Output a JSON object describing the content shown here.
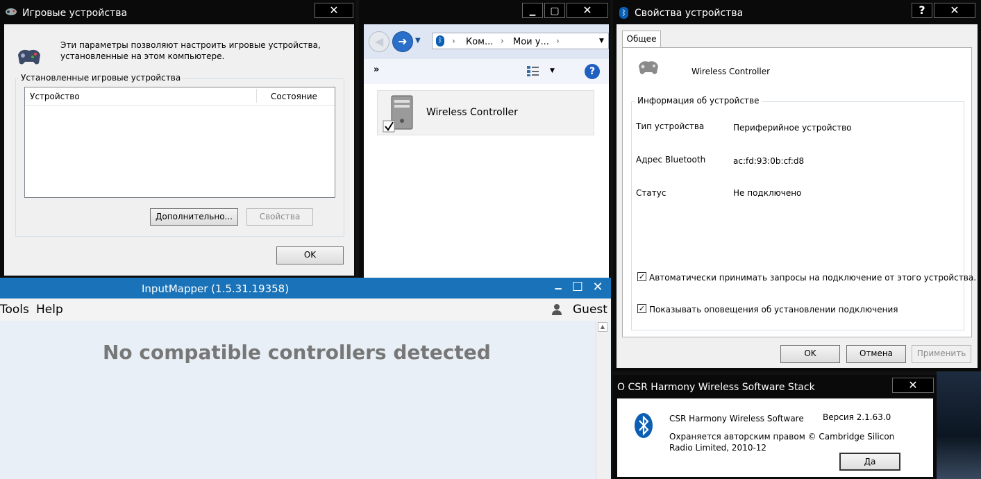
{
  "game_devices": {
    "title": "Игровые устройства",
    "description": "Эти параметры позволяют настроить игровые устройства, установленные на этом компьютере.",
    "group_label": "Установленные игровые устройства",
    "columns": [
      "Устройство",
      "Состояние"
    ],
    "advanced_label": "Дополнительно...",
    "properties_label": "Свойства",
    "ok_label": "OK",
    "close_symbol": "✕"
  },
  "explorer": {
    "breadcrumb": [
      "Ком...",
      "Мои у..."
    ],
    "overflow_symbol": "»",
    "help_symbol": "?",
    "device_name": "Wireless Controller",
    "min_symbol": "▁",
    "max_symbol": "▢",
    "close_symbol": "✕"
  },
  "props": {
    "title": "Свойства устройства",
    "tab": "Общее",
    "device_name": "Wireless Controller",
    "info_group": "Информация об устройстве",
    "rows": [
      {
        "label": "Тип устройства",
        "value": "Периферийное устройство"
      },
      {
        "label": "Адрес Bluetooth",
        "value": "ac:fd:93:0b:cf:d8"
      },
      {
        "label": "Статус",
        "value": "Не подключено"
      }
    ],
    "checkbox1": "Автоматически принимать запросы на подключение от этого устройства.",
    "checkbox2": "Показывать оповещения об установлении подключения",
    "ok_label": "OK",
    "cancel_label": "Отмена",
    "apply_label": "Применить",
    "help_symbol": "?",
    "close_symbol": "✕"
  },
  "inputmapper": {
    "title": "InputMapper (1.5.31.19358)",
    "menu": [
      "Tools",
      "Help"
    ],
    "user": "Guest",
    "message": "No compatible controllers detected",
    "min_symbol": "▁",
    "max_symbol": "☐",
    "close_symbol": "✕"
  },
  "csr": {
    "title": "О CSR Harmony Wireless Software Stack",
    "product": "CSR Harmony Wireless Software",
    "version": "Версия 2.1.63.0",
    "copyright": "Охраняется авторским правом © Cambridge Silicon Radio Limited, 2010-12",
    "yes_label": "Да",
    "close_symbol": "✕"
  },
  "colors": {
    "inputmapper_title": "#1a73b8",
    "bluetooth_blue": "#0a5fb4"
  }
}
